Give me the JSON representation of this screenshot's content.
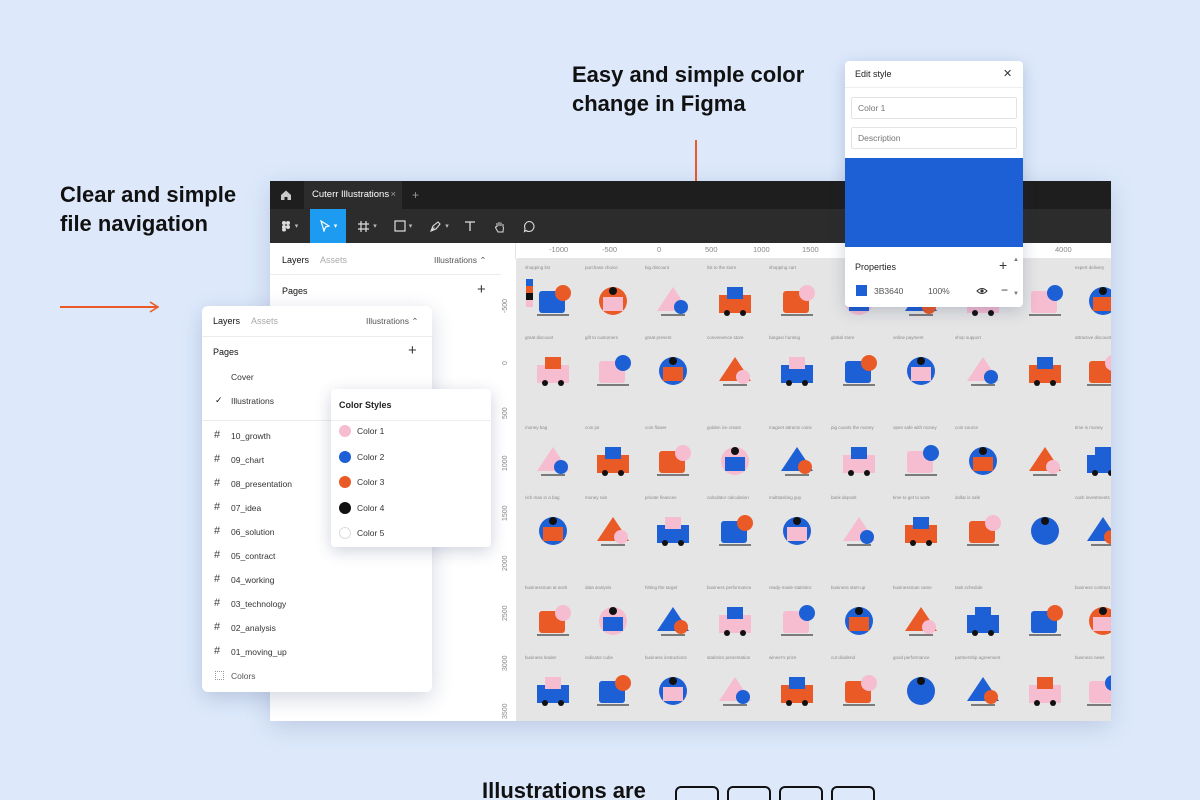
{
  "headlines": {
    "left": "Clear and simple file navigation",
    "top": "Easy and simple color change in Figma",
    "bottom": "Illustrations are"
  },
  "colors": {
    "background": "#dde9fb",
    "accent_orange": "#ea5a26",
    "brand_blue": "#1d5fd4",
    "pink": "#f6bcd0",
    "black": "#111111"
  },
  "figma": {
    "file_tab": "Cuterr Illustrations",
    "tab_close": "×",
    "new_tab": "+",
    "left_panel": {
      "tab_layers": "Layers",
      "tab_assets": "Assets",
      "page_selector": "Illustrations ⌃",
      "pages_label": "Pages",
      "add": "+"
    },
    "ruler_top": [
      "-1000",
      "-500",
      "0",
      "500",
      "1000",
      "1500",
      "4000"
    ],
    "ruler_left": [
      "-500",
      "0",
      "500",
      "1000",
      "1500",
      "2000",
      "2500",
      "3000",
      "3500"
    ],
    "illustration_rows": [
      [
        "shopping list",
        "purchase choice",
        "big discount",
        "list to the store",
        "shopping cart",
        "",
        "",
        "",
        "",
        "expert delivery"
      ],
      [
        "great discount",
        "gift to customers",
        "great present",
        "convenience store",
        "bargain hunting",
        "global store",
        "online payment",
        "shop support",
        "",
        "attractive discounts"
      ],
      [
        "money bag",
        "coin jar",
        "coin flower",
        "golden ice cream",
        "magnet attracts coins",
        "pig counts the money",
        "open safe with money",
        "coin source",
        "",
        "time is money"
      ],
      [
        "rich man in a bag",
        "money rain",
        "private finances",
        "calculator calculation",
        "multitasking guy",
        "bank deposit",
        "time to get to work",
        "dollar is safe",
        "",
        "cash investments"
      ],
      [
        "businessman at work",
        "data analysis",
        "hitting the target",
        "business performance",
        "ready-made statistics",
        "business start-up",
        "businessman came",
        "task schedule",
        "",
        "business contract"
      ],
      [
        "business leader",
        "indicator cube",
        "business instructions",
        "statistics presentation",
        "winner's prize",
        "cut dividend",
        "good performance",
        "partnership agreement",
        "",
        "business news"
      ]
    ]
  },
  "layers_panel": {
    "tab_layers": "Layers",
    "tab_assets": "Assets",
    "page_selector": "Illustrations ⌃",
    "pages_label": "Pages",
    "add": "+",
    "pages": [
      "Cover",
      "Illustrations"
    ],
    "checked_page": "✓",
    "frames": [
      "10_growth",
      "09_chart",
      "08_presentation",
      "07_idea",
      "06_solution",
      "05_contract",
      "04_working",
      "03_technology",
      "02_analysis",
      "01_moving_up"
    ],
    "colors_item": "Colors",
    "frame_icon": "#"
  },
  "color_styles": {
    "title": "Color Styles",
    "items": [
      {
        "label": "Color 1",
        "color": "#f6bcd0"
      },
      {
        "label": "Color 2",
        "color": "#1d5fd4"
      },
      {
        "label": "Color 3",
        "color": "#ea5a26"
      },
      {
        "label": "Color 4",
        "color": "#111111"
      },
      {
        "label": "Color 5",
        "color": "#ffffff"
      }
    ]
  },
  "edit_style": {
    "title": "Edit style",
    "close": "✕",
    "name_value": "Color 1",
    "description_placeholder": "Description",
    "swatch_color": "#1d5fd4",
    "properties_label": "Properties",
    "add": "+",
    "hex": "3B3640",
    "opacity": "100%",
    "remove": "−"
  }
}
